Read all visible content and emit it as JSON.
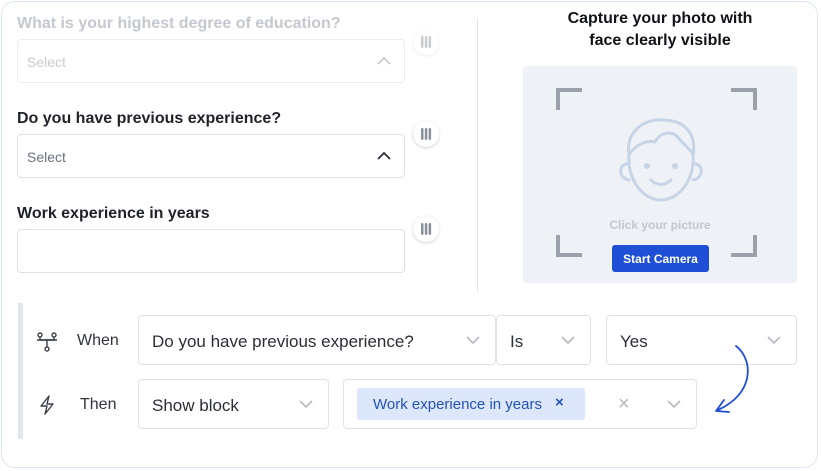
{
  "questions": [
    {
      "label": "What is your highest degree of education?",
      "placeholder": "Select"
    },
    {
      "label": "Do you have previous experience?",
      "placeholder": "Select"
    },
    {
      "label": "Work experience in years",
      "value": ""
    }
  ],
  "capture": {
    "title_line1": "Capture your photo with",
    "title_line2": "face clearly visible",
    "hint": "Click your picture",
    "button": "Start Camera"
  },
  "logic": {
    "when": {
      "label": "When",
      "field": "Do you have previous experience?",
      "operator": "Is",
      "value": "Yes"
    },
    "then": {
      "label": "Then",
      "action": "Show block",
      "target": "Work experience in years",
      "chip_remove": "×",
      "clear": "×"
    }
  },
  "colors": {
    "accent": "#1f4fd6",
    "chip_bg": "#dce7fb",
    "chip_text": "#2452b8",
    "arrow": "#1f4fd6"
  },
  "icons": [
    "chevron-up-icon",
    "drag-handle-icon",
    "face-icon",
    "branch-icon",
    "lightning-icon",
    "chevron-down-icon",
    "close-icon",
    "curved-arrow-icon"
  ]
}
